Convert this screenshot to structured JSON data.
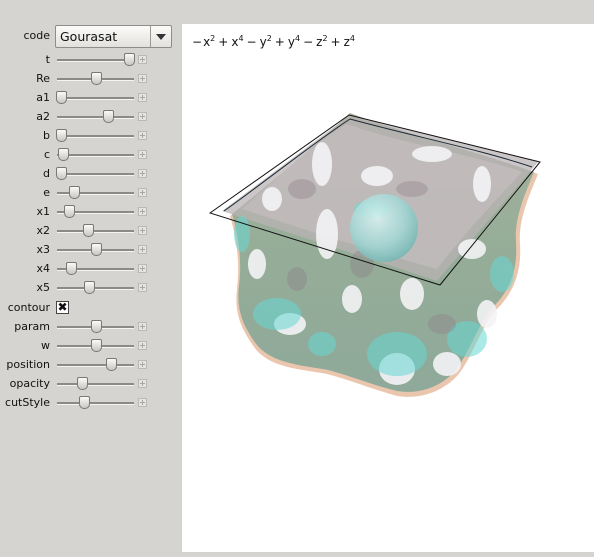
{
  "controls": {
    "code": {
      "label": "code",
      "value": "Gourasat"
    },
    "sliders": [
      {
        "name": "t",
        "label": "t",
        "value": 0.93
      },
      {
        "name": "re",
        "label": "Re",
        "value": 0.5
      },
      {
        "name": "a1",
        "label": "a1",
        "value": 0.05
      },
      {
        "name": "a2",
        "label": "a2",
        "value": 0.66
      },
      {
        "name": "b",
        "label": "b",
        "value": 0.05
      },
      {
        "name": "c",
        "label": "c",
        "value": 0.08
      },
      {
        "name": "d",
        "label": "d",
        "value": 0.05
      },
      {
        "name": "e",
        "label": "e",
        "value": 0.22
      },
      {
        "name": "x1",
        "label": "x1",
        "value": 0.15
      },
      {
        "name": "x2",
        "label": "x2",
        "value": 0.4
      },
      {
        "name": "x3",
        "label": "x3",
        "value": 0.5
      },
      {
        "name": "x4",
        "label": "x4",
        "value": 0.18
      },
      {
        "name": "x5",
        "label": "x5",
        "value": 0.42
      }
    ],
    "contour": {
      "label": "contour",
      "checked": true,
      "mark": "✖"
    },
    "sliders2": [
      {
        "name": "param",
        "label": "param",
        "value": 0.5
      },
      {
        "name": "w",
        "label": "w",
        "value": 0.5
      },
      {
        "name": "position",
        "label": "position",
        "value": 0.7
      },
      {
        "name": "opacity",
        "label": "opacity",
        "value": 0.33
      },
      {
        "name": "cutstyle",
        "label": "cutStyle",
        "value": 0.35
      }
    ]
  },
  "plot": {
    "formula_terms": [
      {
        "sign": "−",
        "base": "x",
        "exp": "2"
      },
      {
        "sign": "+",
        "base": "x",
        "exp": "4"
      },
      {
        "sign": "−",
        "base": "y",
        "exp": "2"
      },
      {
        "sign": "+",
        "base": "y",
        "exp": "4"
      },
      {
        "sign": "−",
        "base": "z",
        "exp": "2"
      },
      {
        "sign": "+",
        "base": "z",
        "exp": "4"
      }
    ],
    "colors": {
      "surface": "#9fb8a2",
      "blob": "#c6f0f2",
      "highlight": "#5fd8d4",
      "edge": "#e8b08c"
    }
  }
}
